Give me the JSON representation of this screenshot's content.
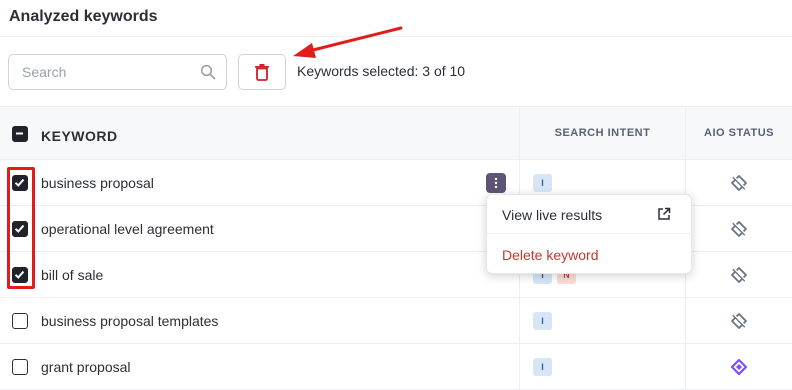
{
  "header": {
    "title": "Analyzed keywords"
  },
  "toolbar": {
    "search_placeholder": "Search",
    "selected_label": "Keywords selected: 3 of 10"
  },
  "table": {
    "columns": {
      "keyword": "KEYWORD",
      "intent": "SEARCH INTENT",
      "aio": "AIO STATUS"
    },
    "rows": [
      {
        "keyword": "business proposal",
        "checked": true,
        "intents": [
          "I"
        ],
        "aio": "no-aio-icon"
      },
      {
        "keyword": "operational level agreement",
        "checked": true,
        "intents": [],
        "aio": "no-aio-icon"
      },
      {
        "keyword": "bill of sale",
        "checked": true,
        "intents": [
          "I",
          "N"
        ],
        "aio": "no-aio-icon"
      },
      {
        "keyword": "business proposal templates",
        "checked": false,
        "intents": [
          "I"
        ],
        "aio": "no-aio-icon"
      },
      {
        "keyword": "grant proposal",
        "checked": false,
        "intents": [
          "I"
        ],
        "aio": "aio-present-icon"
      }
    ]
  },
  "context_menu": {
    "view_live": "View live results",
    "delete": "Delete keyword"
  },
  "colors": {
    "annotation_red": "#e21b1b",
    "delete_red": "#d0202a",
    "menu_button": "#5d5575",
    "aio_present": "#7c4dff",
    "intent_i_bg": "#d6e6f6",
    "intent_n_bg": "#fbdcd8"
  }
}
